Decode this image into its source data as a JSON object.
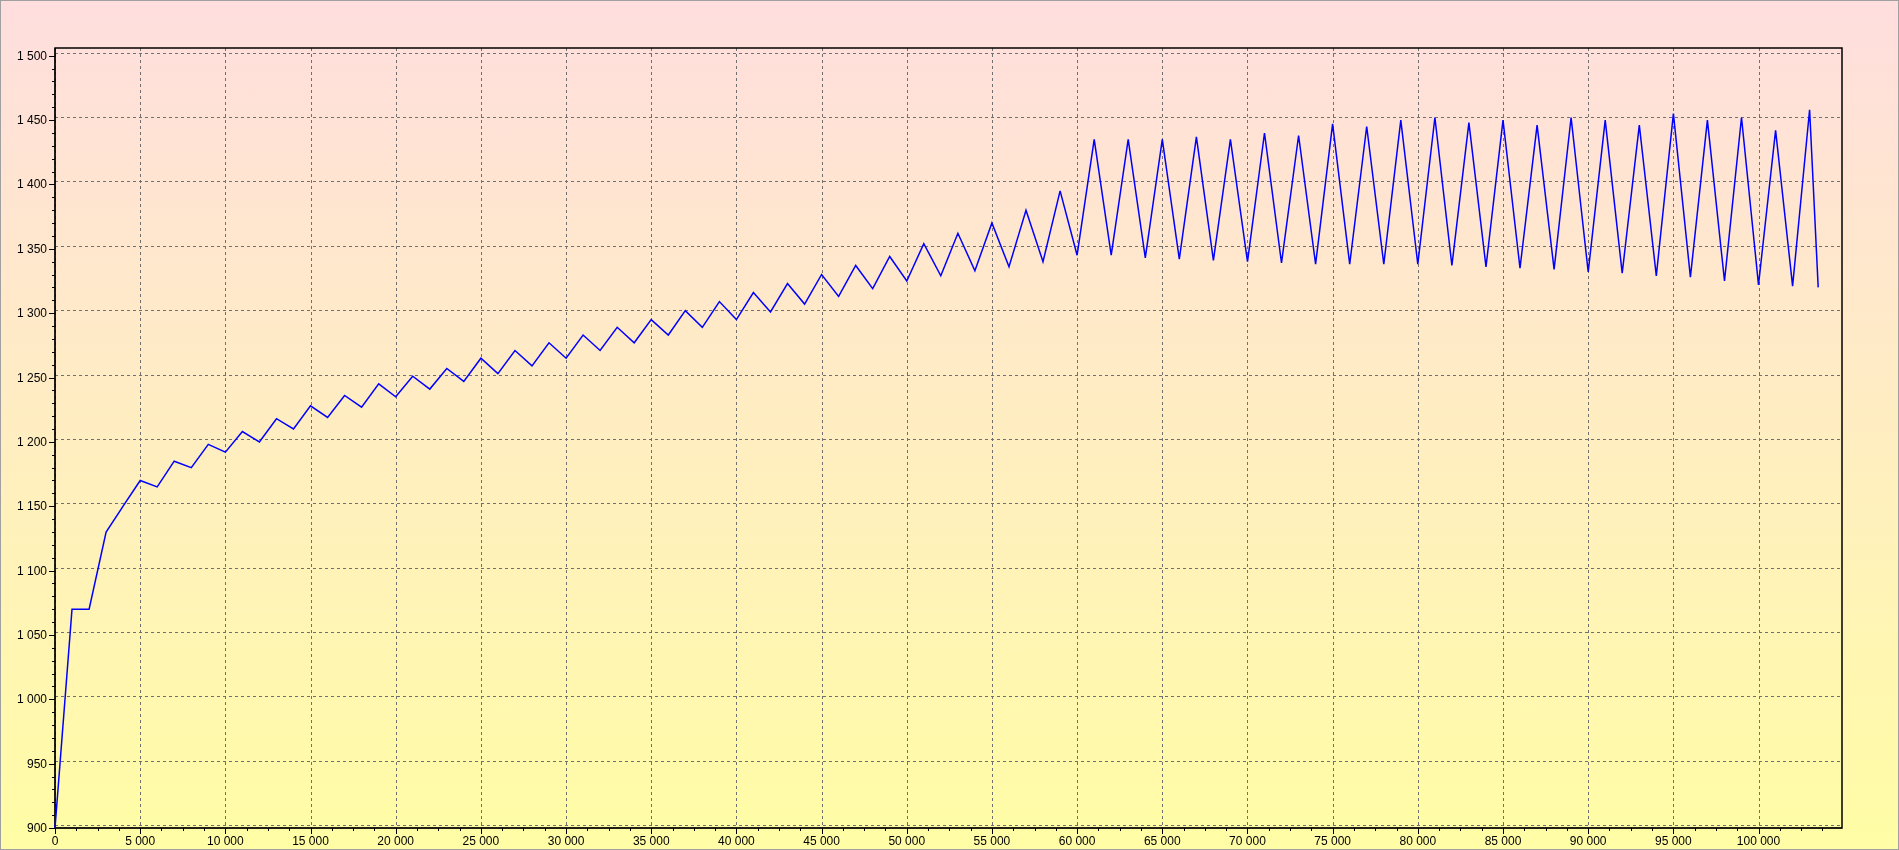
{
  "chart": {
    "chart_data": {
      "type": "line",
      "grid": true,
      "x": [
        0,
        1000,
        2000,
        3000,
        4000,
        5000,
        6000,
        7000,
        8000,
        9000,
        10000,
        11000,
        12000,
        13000,
        14000,
        15000,
        16000,
        17000,
        18000,
        19000,
        20000,
        21000,
        22000,
        23000,
        24000,
        25000,
        26000,
        27000,
        28000,
        29000,
        30000,
        31000,
        32000,
        33000,
        34000,
        35000,
        36000,
        37000,
        38000,
        39000,
        40000,
        41000,
        42000,
        43000,
        44000,
        45000,
        46000,
        47000,
        48000,
        49000,
        50000,
        51000,
        52000,
        53000,
        54000,
        55000,
        56000,
        57000,
        58000,
        59000,
        60000,
        61000,
        62000,
        63000,
        64000,
        65000,
        66000,
        67000,
        68000,
        69000,
        70000,
        71000,
        72000,
        73000,
        74000,
        75000,
        76000,
        77000,
        78000,
        79000,
        80000,
        81000,
        82000,
        83000,
        84000,
        85000,
        86000,
        87000,
        88000,
        89000,
        90000,
        91000,
        92000,
        93000,
        94000,
        95000,
        96000,
        97000,
        98000,
        99000,
        100000,
        101000,
        102000,
        103000,
        103500
      ],
      "series": [
        {
          "color": "#0000ff",
          "values": [
            900,
            1070,
            1070,
            1130,
            1150,
            1170,
            1165,
            1185,
            1180,
            1198,
            1192,
            1208,
            1200,
            1218,
            1210,
            1228,
            1219,
            1236,
            1227,
            1245,
            1235,
            1251,
            1241,
            1257,
            1247,
            1265,
            1253,
            1271,
            1259,
            1277,
            1265,
            1283,
            1271,
            1289,
            1277,
            1295,
            1283,
            1302,
            1289,
            1309,
            1295,
            1316,
            1301,
            1323,
            1307,
            1330,
            1313,
            1337,
            1319,
            1344,
            1325,
            1354,
            1329,
            1362,
            1333,
            1370,
            1336,
            1380,
            1340,
            1395,
            1345,
            1435,
            1345,
            1435,
            1343,
            1435,
            1342,
            1437,
            1341,
            1435,
            1340,
            1440,
            1339,
            1438,
            1338,
            1447,
            1338,
            1445,
            1338,
            1450,
            1338,
            1452,
            1337,
            1448,
            1336,
            1450,
            1335,
            1446,
            1334,
            1452,
            1332,
            1450,
            1331,
            1446,
            1329,
            1455,
            1328,
            1450,
            1325,
            1452,
            1322,
            1442,
            1321,
            1458,
            1320
          ]
        }
      ],
      "xlim": [
        0,
        104900
      ],
      "ylim": [
        900,
        1506
      ],
      "xticks": [
        {
          "value": 0,
          "label": "0"
        },
        {
          "value": 5000,
          "label": "5 000"
        },
        {
          "value": 10000,
          "label": "10 000"
        },
        {
          "value": 15000,
          "label": "15 000"
        },
        {
          "value": 20000,
          "label": "20 000"
        },
        {
          "value": 25000,
          "label": "25 000"
        },
        {
          "value": 30000,
          "label": "30 000"
        },
        {
          "value": 35000,
          "label": "35 000"
        },
        {
          "value": 40000,
          "label": "40 000"
        },
        {
          "value": 45000,
          "label": "45 000"
        },
        {
          "value": 50000,
          "label": "50 000"
        },
        {
          "value": 55000,
          "label": "55 000"
        },
        {
          "value": 60000,
          "label": "60 000"
        },
        {
          "value": 65000,
          "label": "65 000"
        },
        {
          "value": 70000,
          "label": "70 000"
        },
        {
          "value": 75000,
          "label": "75 000"
        },
        {
          "value": 80000,
          "label": "80 000"
        },
        {
          "value": 85000,
          "label": "85 000"
        },
        {
          "value": 90000,
          "label": "90 000"
        },
        {
          "value": 95000,
          "label": "95 000"
        },
        {
          "value": 100000,
          "label": "100 000"
        }
      ],
      "yticks": [
        {
          "value": 900,
          "label": "900"
        },
        {
          "value": 950,
          "label": "950"
        },
        {
          "value": 1000,
          "label": "1 000"
        },
        {
          "value": 1050,
          "label": "1 050"
        },
        {
          "value": 1100,
          "label": "1 100"
        },
        {
          "value": 1150,
          "label": "1 150"
        },
        {
          "value": 1200,
          "label": "1 200"
        },
        {
          "value": 1250,
          "label": "1 250"
        },
        {
          "value": 1300,
          "label": "1 300"
        },
        {
          "value": 1350,
          "label": "1 350"
        },
        {
          "value": 1400,
          "label": "1 400"
        },
        {
          "value": 1450,
          "label": "1 450"
        },
        {
          "value": 1500,
          "label": "1 500"
        }
      ]
    }
  }
}
